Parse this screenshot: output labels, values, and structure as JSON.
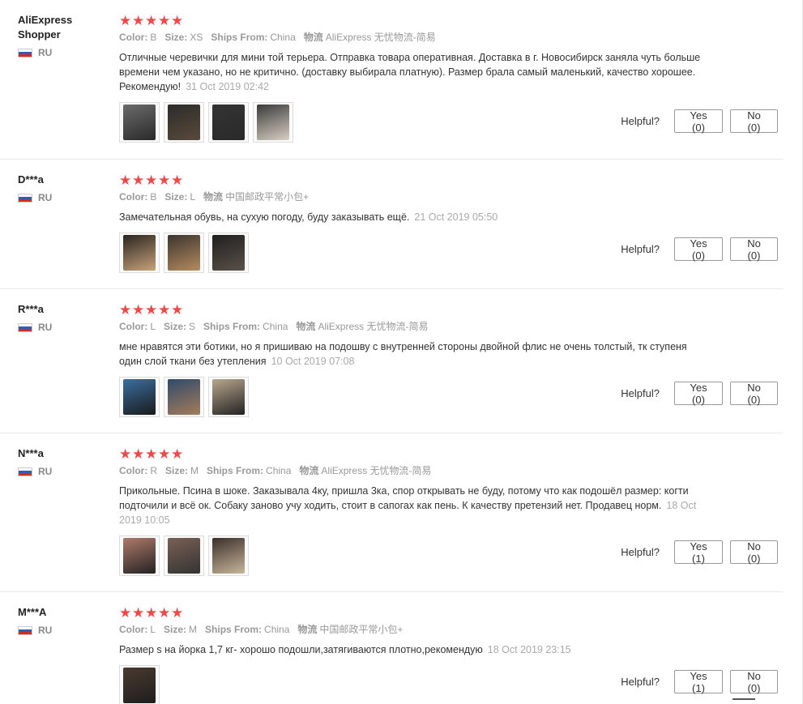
{
  "labels": {
    "helpful": "Helpful?"
  },
  "colors": {
    "star": "#f04848",
    "text": "#333333",
    "muted": "#999999"
  },
  "icons": {
    "star": "★",
    "flag": "russia-flag-icon"
  },
  "reviews": [
    {
      "user": "AliExpress Shopper",
      "country": "RU",
      "stars": 5,
      "attrs": [
        {
          "key": "Color:",
          "value": "B"
        },
        {
          "key": "Size:",
          "value": "XS"
        },
        {
          "key": "Ships From:",
          "value": "China"
        },
        {
          "key": "物流",
          "value": "AliExpress 无忧物流-简易"
        }
      ],
      "text": "Отличные черевички для мини той терьера. Отправка товара оперативная. Доставка в г. Новосибирск заняла чуть больше времени чем указано, но не критично. (доставку выбирала платную). Размер брала самый маленький, качество хорошее. Рекомендую!",
      "date": "31 Oct 2019 02:42",
      "thumbs": 4,
      "yes": "Yes (0)",
      "no": "No (0)"
    },
    {
      "user": "D***a",
      "country": "RU",
      "stars": 5,
      "attrs": [
        {
          "key": "Color:",
          "value": "B"
        },
        {
          "key": "Size:",
          "value": "L"
        },
        {
          "key": "物流",
          "value": "中国邮政平常小包+"
        }
      ],
      "text": "Замечательная обувь, на сухую погоду, буду заказывать ещё.",
      "date": "21 Oct 2019 05:50",
      "thumbs": 3,
      "yes": "Yes (0)",
      "no": "No (0)"
    },
    {
      "user": "R***a",
      "country": "RU",
      "stars": 5,
      "attrs": [
        {
          "key": "Color:",
          "value": "L"
        },
        {
          "key": "Size:",
          "value": "S"
        },
        {
          "key": "Ships From:",
          "value": "China"
        },
        {
          "key": "物流",
          "value": "AliExpress 无忧物流-简易"
        }
      ],
      "text": "мне нравятся эти ботики, но я пришиваю на подошву с внутренней стороны двойной флис не очень толстый, тк ступеня один слой ткани без утепления",
      "date": "10 Oct 2019 07:08",
      "thumbs": 3,
      "yes": "Yes (0)",
      "no": "No (0)"
    },
    {
      "user": "N***a",
      "country": "RU",
      "stars": 5,
      "attrs": [
        {
          "key": "Color:",
          "value": "R"
        },
        {
          "key": "Size:",
          "value": "M"
        },
        {
          "key": "Ships From:",
          "value": "China"
        },
        {
          "key": "物流",
          "value": "AliExpress 无忧物流-简易"
        }
      ],
      "text": "Прикольные. Псина в шоке. Заказывала 4ку, пришла 3ка, спор открывать не буду, потому что как подошёл размер: когти подточили и всё ок. Собаку заново учу ходить, стоит в сапогах как пень. К качеству претензий нет. Продавец норм.",
      "date": "18 Oct 2019 10:05",
      "thumbs": 3,
      "yes": "Yes (1)",
      "no": "No (0)"
    },
    {
      "user": "M***A",
      "country": "RU",
      "stars": 5,
      "attrs": [
        {
          "key": "Color:",
          "value": "L"
        },
        {
          "key": "Size:",
          "value": "M"
        },
        {
          "key": "Ships From:",
          "value": "China"
        },
        {
          "key": "物流",
          "value": "中国邮政平常小包+"
        }
      ],
      "text": "Размер s на йорка 1,7 кг- хорошо подошли,затягиваются плотно,рекомендую",
      "date": "18 Oct 2019 23:15",
      "thumbs": 1,
      "yes": "Yes (1)",
      "no": "No (0)"
    }
  ]
}
